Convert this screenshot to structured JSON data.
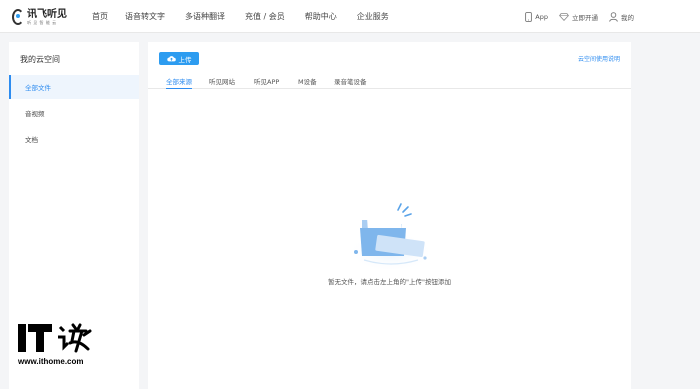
{
  "header": {
    "logo": {
      "title": "讯飞听见",
      "subtitle": "听 见 智 能 云"
    },
    "nav": [
      "首页",
      "语音转文字",
      "多语种翻译",
      "充值 / 会员",
      "帮助中心",
      "企业服务"
    ],
    "right": {
      "app": "App",
      "vip": "立即开通",
      "account": "我的"
    }
  },
  "sidebar": {
    "title": "我的云空间",
    "items": [
      {
        "label": "全部文件",
        "active": true
      },
      {
        "label": "音视频",
        "active": false
      },
      {
        "label": "文档",
        "active": false
      }
    ]
  },
  "main": {
    "upload_label": "上传",
    "help_link": "云空间使用说明",
    "tabs": [
      {
        "label": "全部来源",
        "active": true
      },
      {
        "label": "听见网站",
        "active": false
      },
      {
        "label": "听见APP",
        "active": false
      },
      {
        "label": "M设备",
        "active": false
      },
      {
        "label": "录音笔设备",
        "active": false
      }
    ],
    "empty_text": "暂无文件，请点击左上角的\"上传\"按钮添加"
  },
  "watermark": {
    "brand": "IT之家",
    "url": "www.ithome.com"
  },
  "colors": {
    "accent": "#2d8cf0",
    "upload_button": "#2d9cf0",
    "active_bg": "#eef5fd"
  }
}
